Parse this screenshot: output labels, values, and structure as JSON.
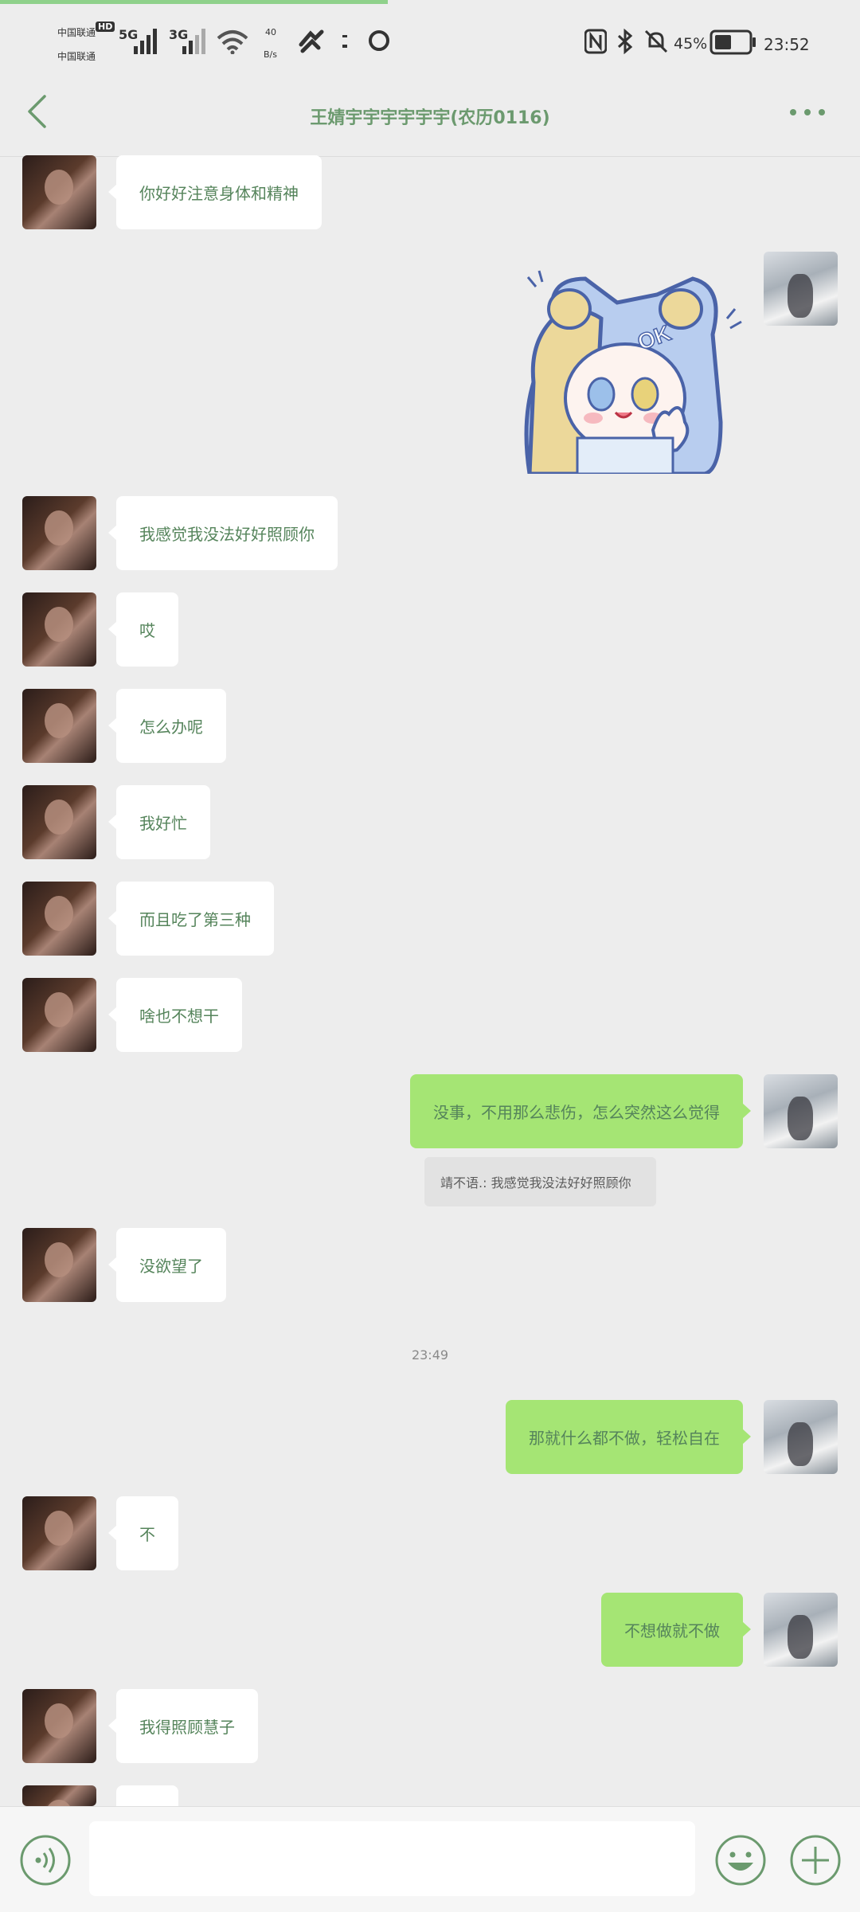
{
  "status_bar": {
    "carrier1": "中国联通",
    "carrier2": "中国联通",
    "hd": "HD",
    "net1": "5G",
    "net2": "3G",
    "speed_value": "40",
    "speed_unit": "B/s",
    "battery": "45%",
    "time": "23:52"
  },
  "header": {
    "title": "王婧宇宇宇宇宇宇(农历0116)"
  },
  "messages": {
    "m1": "你好好注意身体和精神",
    "m2": "我感觉我没法好好照顾你",
    "m3": "哎",
    "m4": "怎么办呢",
    "m5": "我好忙",
    "m6": "而且吃了第三种",
    "m7": "啥也不想干",
    "m8": "没事，不用那么悲伤，怎么突然这么觉得",
    "quote": "靖不语.: 我感觉我没法好好照顾你",
    "m9": "没欲望了",
    "timestamp": "23:49",
    "m10": "那就什么都不做，轻松自在",
    "m11": "不",
    "m12": "不想做就不做",
    "m13": "我得照顾慧子"
  },
  "sticker": {
    "text": "OK"
  },
  "colors": {
    "accent": "#55845b",
    "bubble_out": "#a5e574",
    "bubble_in": "#ffffff",
    "background": "#ededed"
  }
}
